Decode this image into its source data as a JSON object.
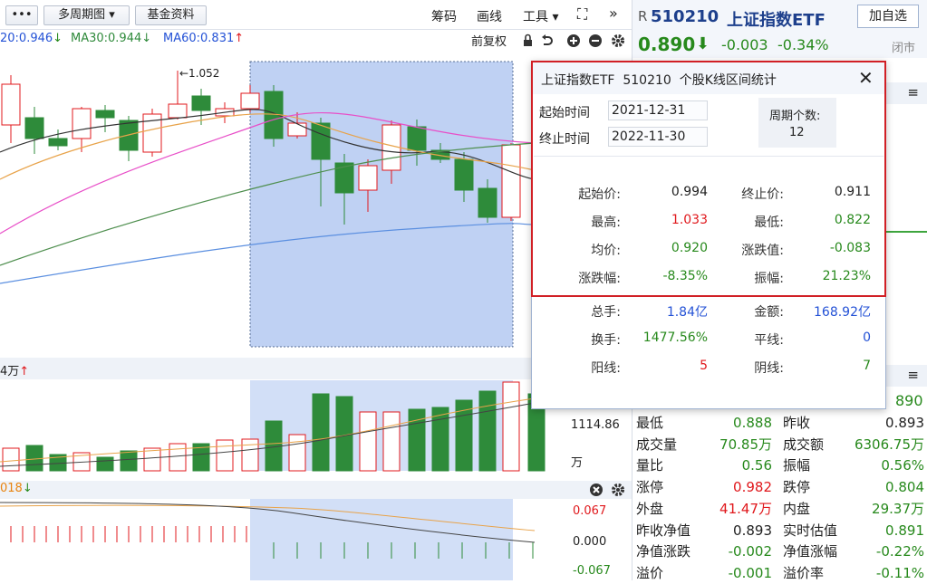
{
  "toolbar": {
    "more_label": "•••",
    "period_label": "多周期图 ▾",
    "fund_label": "基金资料",
    "links": [
      "筹码",
      "画线",
      "工具 ▾"
    ],
    "expand_glyph": "⛶",
    "chev_glyph": "»"
  },
  "ma_bar": {
    "ma20": "20:0.946",
    "ma30": "MA30:0.944",
    "ma60": "MA60:0.831",
    "adjust": "前复权"
  },
  "main_chart": {
    "high_label": "←1.052",
    "colors": {
      "up": "#e0181c",
      "down": "#2e8b3a",
      "ma5": "#333333",
      "ma10": "#e8a34a",
      "ma20": "#e84fc8",
      "ma30": "#4f8f4f",
      "ma60": "#5b8fe0",
      "highlight": "#7fa3e8"
    }
  },
  "volume": {
    "header": "4万",
    "axis_value": "1114.86",
    "axis_unit": "万"
  },
  "macd": {
    "header": "018",
    "ticks": [
      "0.067",
      "0.000",
      "-0.067"
    ]
  },
  "quote": {
    "prefix": "R",
    "code": "510210",
    "name": "上证指数ETF",
    "add_btn": "加自选",
    "price": "0.890",
    "change": "-0.003",
    "pct": "-0.34%",
    "status": "闭市",
    "partial": "890"
  },
  "quote_rows": [
    {
      "l1": "最低",
      "v1": "0.888",
      "c1": "green",
      "l2": "昨收",
      "v2": "0.893",
      "c2": "black"
    },
    {
      "l1": "成交量",
      "v1": "70.85万",
      "c1": "green",
      "l2": "成交额",
      "v2": "6306.75万",
      "c2": "green"
    },
    {
      "l1": "量比",
      "v1": "0.56",
      "c1": "green",
      "l2": "振幅",
      "v2": "0.56%",
      "c2": "green"
    },
    {
      "l1": "涨停",
      "v1": "0.982",
      "c1": "red",
      "l2": "跌停",
      "v2": "0.804",
      "c2": "green"
    },
    {
      "l1": "外盘",
      "v1": "41.47万",
      "c1": "red",
      "l2": "内盘",
      "v2": "29.37万",
      "c2": "green"
    },
    {
      "l1": "昨收净值",
      "v1": "0.893",
      "c1": "black",
      "l2": "实时估值",
      "v2": "0.891",
      "c2": "green"
    },
    {
      "l1": "净值涨跌",
      "v1": "-0.002",
      "c1": "green",
      "l2": "净值涨幅",
      "v2": "-0.22%",
      "c2": "green"
    },
    {
      "l1": "溢价",
      "v1": "-0.001",
      "c1": "green",
      "l2": "溢价率",
      "v2": "-0.11%",
      "c2": "green"
    }
  ],
  "popup": {
    "title": "上证指数ETF  510210  个股K线区间统计",
    "start_label": "起始时间",
    "start_value": "2021-12-31",
    "end_label": "终止时间",
    "end_value": "2022-11-30",
    "count_label": "周期个数:",
    "count_value": "12",
    "stats": [
      {
        "l": "起始价:",
        "v": "0.994",
        "c": "black",
        "l2": "终止价:",
        "v2": "0.911",
        "c2": "black"
      },
      {
        "l": "最高:",
        "v": "1.033",
        "c": "red",
        "l2": "最低:",
        "v2": "0.822",
        "c2": "green"
      },
      {
        "l": "均价:",
        "v": "0.920",
        "c": "green",
        "l2": "涨跌值:",
        "v2": "-0.083",
        "c2": "green"
      },
      {
        "l": "涨跌幅:",
        "v": "-8.35%",
        "c": "green",
        "l2": "振幅:",
        "v2": "21.23%",
        "c2": "green"
      },
      {
        "l": "总手:",
        "v": "1.84亿",
        "c": "blue",
        "l2": "金额:",
        "v2": "168.92亿",
        "c2": "blue"
      },
      {
        "l": "换手:",
        "v": "1477.56%",
        "c": "green",
        "l2": "平线:",
        "v2": "0",
        "c2": "blue"
      },
      {
        "l": "阳线:",
        "v": "5",
        "c": "red",
        "l2": "阴线:",
        "v2": "7",
        "c2": "green"
      }
    ]
  }
}
